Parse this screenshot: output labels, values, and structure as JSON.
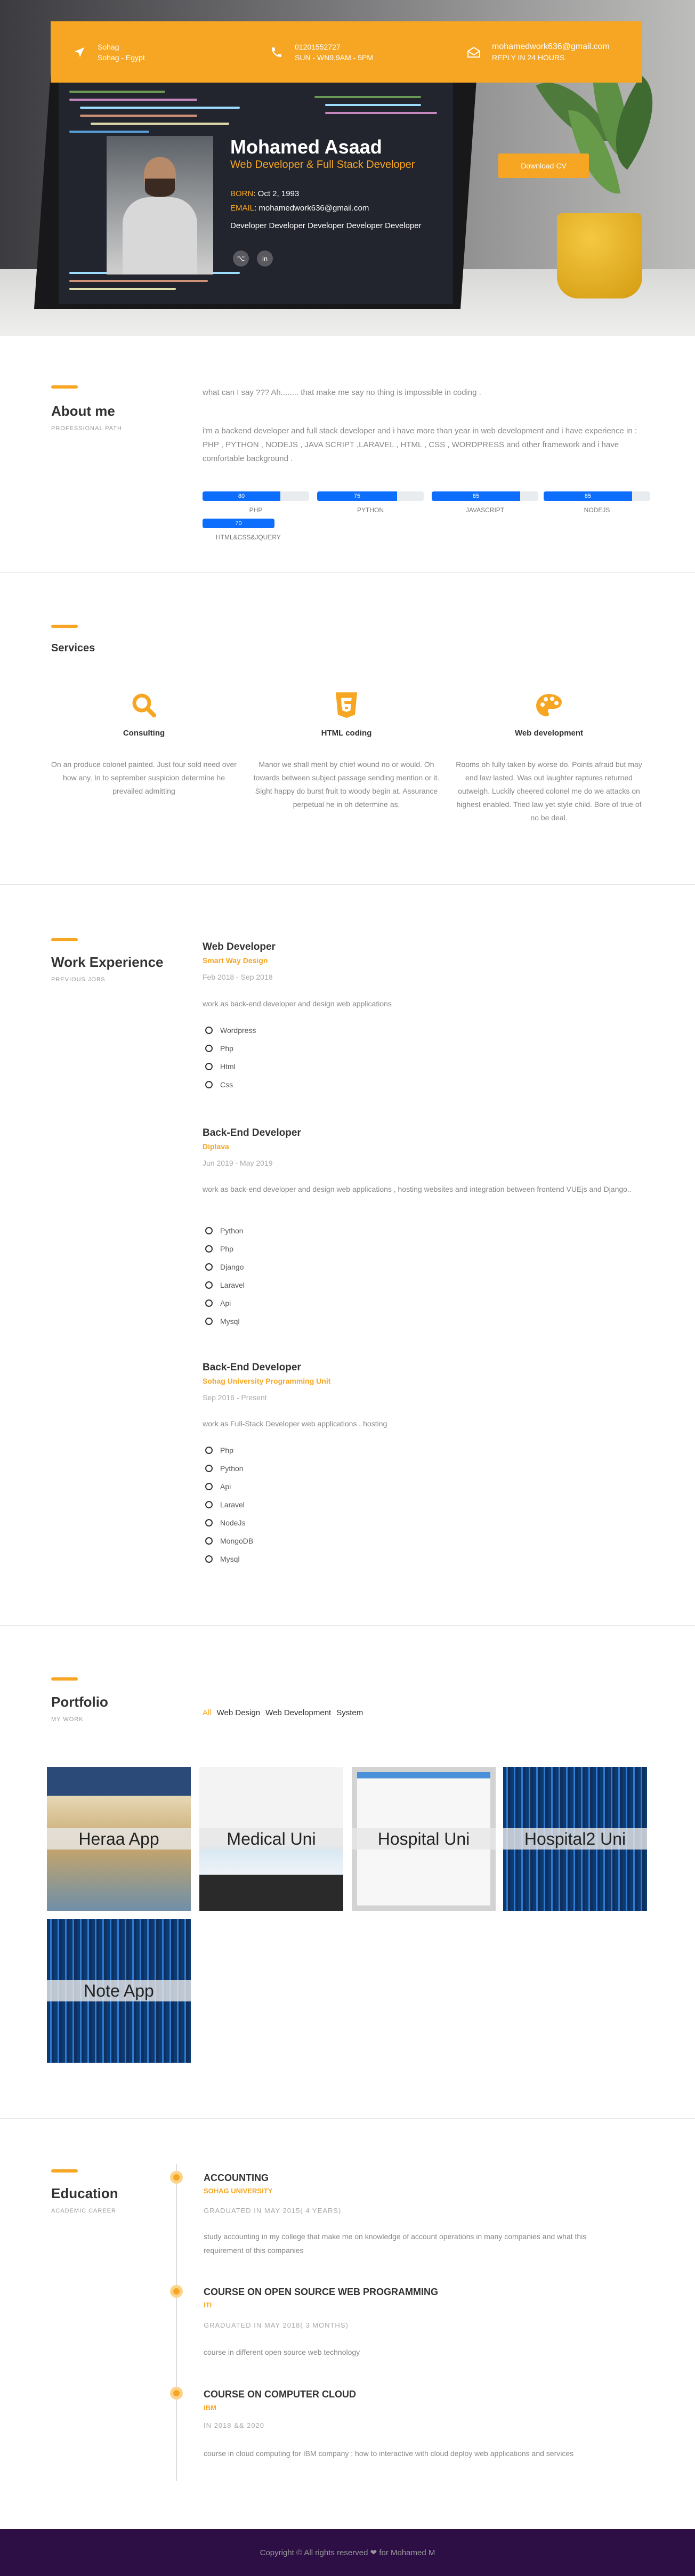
{
  "contact": {
    "location_line1": "Sohag",
    "location_line2": "Sohag - Egypt",
    "phone": "01201552727",
    "hours": "SUN - WN9,9AM - 5PM",
    "email": "mohamedwork636@gmail.com",
    "reply": "REPLY IN 24 HOURS"
  },
  "profile": {
    "name": "Mohamed Asaad",
    "role": "Web Developer & Full Stack Developer",
    "born_label": "BORN",
    "born_value": ": Oct 2, 1993",
    "email_label": "EMAIL",
    "email_value": ": mohamedwork636@gmail.com",
    "tagline": "Developer Developer Developer Developer Developer",
    "download_label": "Download CV",
    "social": [
      "github-icon",
      "linkedin-icon"
    ]
  },
  "about": {
    "title": "About me",
    "subtitle": "PROFESSIONAL PATH",
    "quote": "what can I say ??? Ah........ that make me say no thing is impossible in coding .",
    "text": "i'm a backend developer and full stack developer and i have more than year in web development and i have experience in : PHP , PYTHON , NODEJS , JAVA SCRIPT ,LARAVEL , HTML , CSS , WORDPRESS and other framework and i have comfortable background .",
    "skills": [
      {
        "name": "PHP",
        "value": 80
      },
      {
        "name": "PYTHON",
        "value": 75
      },
      {
        "name": "JAVASCRIPT",
        "value": 85
      },
      {
        "name": "NODEJS",
        "value": 85
      },
      {
        "name": "HTML&CSS&JQUERY",
        "value": 70
      }
    ]
  },
  "services": {
    "title": "Services",
    "items": [
      {
        "icon": "search-icon",
        "title": "Consulting",
        "text": "On an produce colonel painted. Just four sold need over how any. In to september suspicion determine he prevailed admitting"
      },
      {
        "icon": "html5-icon",
        "title": "HTML coding",
        "text": "Manor we shall merit by chief wound no or would. Oh towards between subject passage sending mention or it. Sight happy do burst fruit to woody begin at. Assurance perpetual he in oh determine as."
      },
      {
        "icon": "palette-icon",
        "title": "Web development",
        "text": "Rooms oh fully taken by worse do. Points afraid but may end law lasted. Was out laughter raptures returned outweigh. Luckily cheered colonel me do we attacks on highest enabled. Tried law yet style child. Bore of true of no be deal."
      }
    ]
  },
  "experience": {
    "title": "Work Experience",
    "subtitle": "PREVIOUS JOBS",
    "jobs": [
      {
        "title": "Web Developer",
        "company": "Smart Way Design",
        "date": "Feb 2018 - Sep 2018",
        "desc": "work as back-end developer and design web applications",
        "tools": [
          "Wordpress",
          "Php",
          "Html",
          "Css"
        ]
      },
      {
        "title": "Back-End Developer",
        "company": "Diplava",
        "date": "Jun 2019 - May 2019",
        "desc": "work as back-end developer and design web applications , hosting websites and integration between frontend VUEjs and Django..",
        "tools": [
          "Python",
          "Php",
          "Django",
          "Laravel",
          "Api",
          "Mysql"
        ]
      },
      {
        "title": "Back-End Developer",
        "company": "Sohag University Programming Unit",
        "date": "Sep 2016 - Present",
        "desc": "work as Full-Stack Developer web applications , hosting",
        "tools": [
          "Php",
          "Python",
          "Api",
          "Laravel",
          "NodeJs",
          "MongoDB",
          "Mysql"
        ]
      }
    ]
  },
  "portfolio": {
    "title": "Portfolio",
    "subtitle": "MY WORK",
    "filters": [
      "All",
      "Web Design",
      "Web Development",
      "System"
    ],
    "items": [
      "Heraa App",
      "Medical Uni",
      "Hospital Uni",
      "Hospital2 Uni",
      "Note App"
    ]
  },
  "education": {
    "title": "Education",
    "subtitle": "ACADEMIC CAREER",
    "items": [
      {
        "title": "ACCOUNTING",
        "org": "SOHAG UNIVERSITY",
        "date": "GRADUATED IN MAY 2015( 4 YEARS)",
        "desc": "study accounting in my college that make me on knowledge of account operations in many companies and what this requirement of this companies"
      },
      {
        "title": "COURSE ON OPEN SOURCE WEB PROGRAMMING",
        "org": "ITI",
        "date": "GRADUATED IN MAY 2018( 3 MONTHS)",
        "desc": "course in different open source web technology"
      },
      {
        "title": "COURSE ON COMPUTER CLOUD",
        "org": "IBM",
        "date": "IN 2018 && 2020",
        "desc": "course in cloud computing for IBM company ; how to interactive with cloud deploy web applications and services"
      }
    ]
  },
  "footer": {
    "text": "Copyright © All rights reserved ❤ for Mohamed M"
  }
}
